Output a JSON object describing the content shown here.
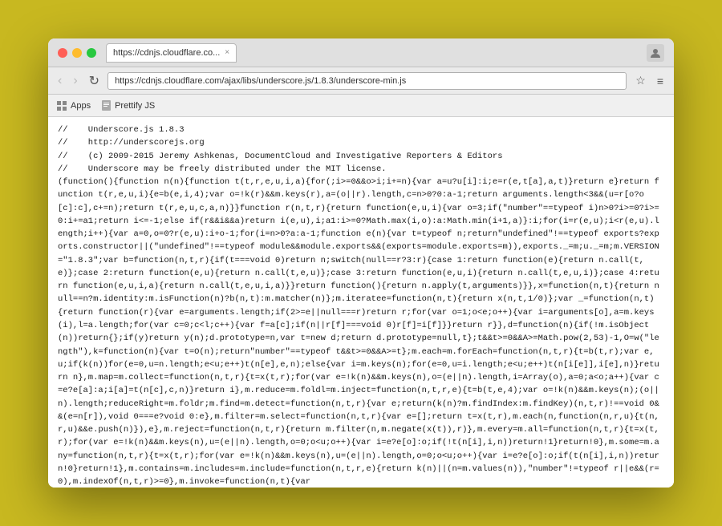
{
  "window": {
    "title": "https://cdnjs.cloudflare.com/ajax/libs/underscore.js/1.8.3/underscore-min.js"
  },
  "titlebar": {
    "tab_url": "https://cdnjs.cloudflare.co...",
    "close_label": "×"
  },
  "navbar": {
    "url": "https://cdnjs.cloudflare.com/ajax/libs/underscore.js/1.8.3/underscore-min.js",
    "back_label": "‹",
    "forward_label": "›",
    "reload_label": "↻",
    "bookmark_label": "☆",
    "menu_label": "≡"
  },
  "toolbar": {
    "apps_label": "Apps",
    "prettify_label": "Prettify JS"
  },
  "code": {
    "content": "//    Underscore.js 1.8.3\n//    http://underscorejs.org\n//    (c) 2009-2015 Jeremy Ashkenas, DocumentCloud and Investigative Reporters & Editors\n//    Underscore may be freely distributed under the MIT license.\n(function(){function n(n){function t(t,r,e,u,i,a){for(;i>=0&&o>i;i+=n){var a=u?u[i]:i;e=r(e,t[a],a,t)}return e}return function t(r,e,u,i){e=b(e,i,4);var o=!k(r)&&m.keys(r),a=(o||r).length,c=n>0?0:a-1;return arguments.length<3&&(u=r[o?o[c]:c],c+=n);return t(r,e,u,c,a,n)}}function r(n,t,r){return function(e,u,i){var o=3;if(\"number\"==typeof i)n>0?i>=0?i>=0:i+=a1;return i<=-1;else if(r&&i&&a)return i(e,u),i;a1:i>=0?Math.max(i,o):a:Math.min(i+1,a)}:i;for(i=r(e,u);i<r(e,u).length;i++){var a=0,o=0?r(e,u):i+o-1;for(i=n>0?a:a-1;function e(n){var t=typeof n;return\"undefined\"!==typeof exports?exports.constructor||(\"undefined\"!==typeof module&&module.exports&&(exports=module.exports=m)),exports._=m;u._=m;m.VERSION=\"1.8.3\";var b=function(n,t,r){if(t===void 0)return n;switch(null==r?3:r){case 1:return function(e){return n.call(t,e)};case 2:return function(e,u){return n.call(t,e,u)};case 3:return function(e,u,i){return n.call(t,e,u,i)};case 4:return function(e,u,i,a){return n.call(t,e,u,i,a)}}return function(){return n.apply(t,arguments)}},x=function(n,t){return null==n?m.identity:m.isFunction(n)?b(n,t):m.matcher(n)};m.iteratee=function(n,t){return x(n,t,1/0)};var _=function(n,t){return function(r){var e=arguments.length;if(2>=e||null===r)return r;for(var o=1;o<e;o++){var i=arguments[o],a=m.keys(i),l=a.length;for(var c=0;c<l;c++){var f=a[c];if(n||r[f]===void 0)r[f]=i[f]}}return r}},d=function(n){if(!m.isObject(n))return{};if(y)return y(n);d.prototype=n,var t=new d;return d.prototype=null,t};t&&t>=0&&A>=Math.pow(2,53)-1,O=w(\"length\"),k=function(n){var t=O(n);return\"number\"==typeof t&&t>=0&&A>=t};m.each=m.forEach=function(n,t,r){t=b(t,r);var e,u;if(k(n))for(e=0,u=n.length;e<u;e++)t(n[e],e,n);else{var i=m.keys(n);for(e=0,u=i.length;e<u;e++)t(n[i[e]],i[e],n)}return n},m.map=m.collect=function(n,t,r){t=x(t,r);for(var e=!k(n)&&m.keys(n),o=(e||n).length,i=Array(o),a=0;a<o;a++){var c=e?e[a]:a;i[a]=t(n[c],c,n)}return i},m.reduce=m.foldl=m.inject=function(n,t,r,e){t=b(t,e,4);var o=!k(n)&&m.keys(n);(o||n).length;reduceRight=m.foldr;m.find=m.detect=function(n,t,r){var e;return(k(n)?m.findIndex:m.findKey)(n,t,r)!==void 0&&(e=n[r]),void 0===e?void 0:e},m.filter=m.select=function(n,t,r){var e=[];return t=x(t,r),m.each(n,function(n,r,u){t(n,r,u)&&e.push(n)}),e},m.reject=function(n,t,r){return m.filter(n,m.negate(x(t)),r)},m.every=m.all=function(n,t,r){t=x(t,r);for(var e=!k(n)&&m.keys(n),u=(e||n).length,o=0;o<u;o++){var i=e?e[o]:o;if(!t(n[i],i,n))return!1}return!0},m.some=m.any=function(n,t,r){t=x(t,r);for(var e=!k(n)&&m.keys(n),u=(e||n).length,o=0;o<u;o++){var i=e?e[o]:o;if(t(n[i],i,n))return!0}return!1},m.contains=m.includes=m.include=function(n,t,r,e){return k(n)||(n=m.values(n)),\"number\"!=typeof r||e&&(r=0),m.indexOf(n,t,r)>=0},m.invoke=function(n,t){var"
  }
}
